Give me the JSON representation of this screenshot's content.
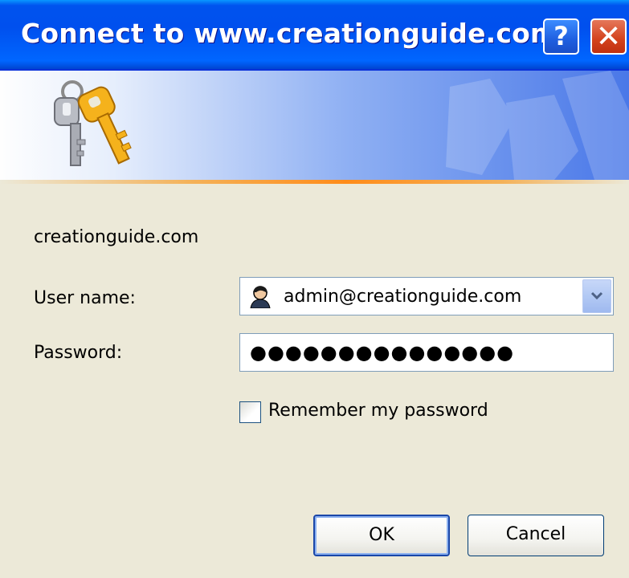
{
  "window": {
    "title": "Connect to www.creationguide.com",
    "help_icon": "help-question-icon",
    "close_icon": "close-x-icon",
    "help_label": "?",
    "close_label": "✕"
  },
  "banner": {
    "icon": "keys-icon"
  },
  "form": {
    "site_name": "creationguide.com",
    "username_label": "User name:",
    "username_value": "admin@creationguide.com",
    "username_icon": "user-icon",
    "password_label": "Password:",
    "password_value": "●●●●●●●●●●●●●●●",
    "remember_label": "Remember my password",
    "remember_checked": false
  },
  "buttons": {
    "ok_label": "OK",
    "cancel_label": "Cancel"
  },
  "colors": {
    "titlebar": "#0054e3",
    "dialog_bg": "#ece9d8",
    "accent_line": "#ff8c1a",
    "close_button": "#d3421c"
  }
}
